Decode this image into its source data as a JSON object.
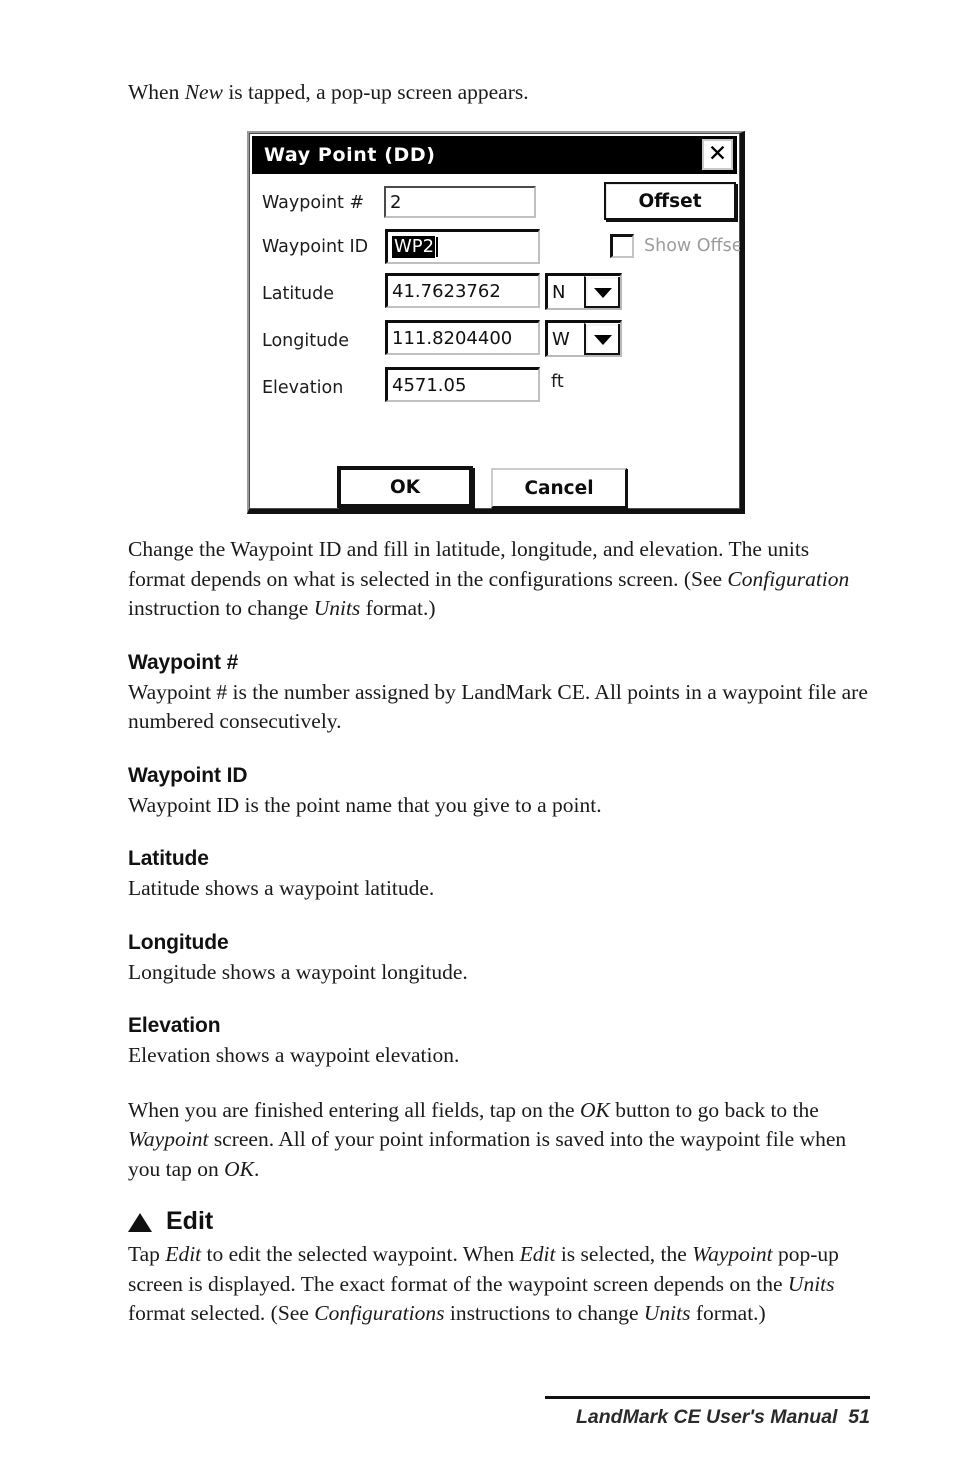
{
  "page": {
    "intro_paragraph_html": "When <em>New</em> is tapped, a pop-up screen appears.",
    "intro_plain": "When New is tapped, a pop-up screen appears."
  },
  "dialog": {
    "title": "Way Point (DD)",
    "close_icon": "close-icon",
    "fields": [
      {
        "label": "Waypoint #",
        "value": "2",
        "selected": false
      },
      {
        "label": "Waypoint ID",
        "value": "WP2",
        "selected": true
      },
      {
        "label": "Latitude",
        "value": "41.7623762",
        "selected": false
      },
      {
        "label": "Longitude",
        "value": "111.8204400",
        "selected": false
      },
      {
        "label": "Elevation",
        "value": "4571.05",
        "selected": false
      }
    ],
    "hemisphere_lat": "N",
    "hemisphere_lon": "W",
    "elevation_unit": "ft",
    "offset_button": "Offset",
    "show_offset_label": "Show Offset",
    "show_offset_checked": false,
    "ok_button": "OK",
    "cancel_button": "Cancel",
    "colors": {
      "titlebar_bg": "#000000",
      "titlebar_fg": "#ffffff",
      "disabled_text": "#9c9c9c",
      "dialog_bg": "#ffffff",
      "border": "#111111"
    }
  },
  "body": {
    "after_dialog_html": "Change the Waypoint ID and fill in latitude, longitude, and elevation. The units format depends on what is selected in the configurations screen. (See <em>Configuration</em> instruction to change <em>Units</em> format.)",
    "sections": [
      {
        "heading": "Waypoint #",
        "text_html": "Waypoint # is the number assigned by LandMark CE. All points in a waypoint file are numbered consecutively."
      },
      {
        "heading": "Waypoint ID",
        "text_html": "Waypoint ID is the point name that you give to a point."
      },
      {
        "heading": "Latitude",
        "text_html": "Latitude shows a waypoint latitude."
      },
      {
        "heading": "Longitude",
        "text_html": "Longitude shows a waypoint longitude."
      },
      {
        "heading": "Elevation",
        "text_html": "Elevation shows a waypoint elevation."
      }
    ],
    "closing_html": "When you are finished entering all fields, tap on the <em>OK</em> button to go back to the <em>Waypoint</em> screen. All of your point information is saved into the waypoint file when you tap on <em>OK</em>.",
    "edit_heading": "Edit",
    "edit_marker_icon": "triangle-up-icon",
    "edit_text_html": "Tap <em>Edit</em> to edit the selected waypoint. When <em>Edit</em> is selected, the <em>Waypoint</em> pop-up screen is displayed. The exact format of the waypoint screen depends on the <em>Units</em> format selected. (See <em>Configurations</em> instructions to change <em>Units</em> format.)"
  },
  "footer": {
    "text": "LandMark CE User's Manual  51"
  }
}
